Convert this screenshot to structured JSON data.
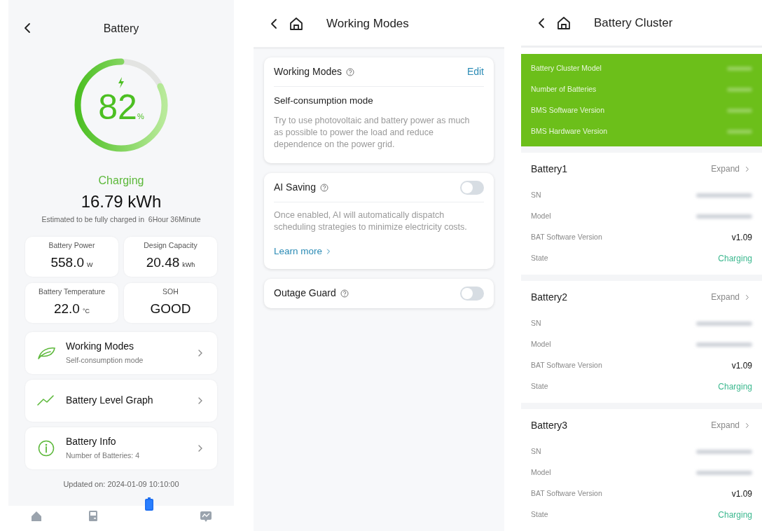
{
  "battery_screen": {
    "title": "Battery",
    "level": 0.82,
    "percent": "82",
    "percent_unit": "%",
    "status": "Charging",
    "energy": "16.79 kWh",
    "estimate": "Estimated to be fully charged in  6Hour 36Minute",
    "stats": [
      {
        "label": "Battery Power",
        "value": "558.0",
        "unit": "W"
      },
      {
        "label": "Design Capacity",
        "value": "20.48",
        "unit": "kWh"
      },
      {
        "label": "Battery Temperature",
        "value": "22.0",
        "unit": "°C"
      },
      {
        "label": "SOH",
        "value": "GOOD"
      }
    ],
    "menu": [
      {
        "kind": "leaf",
        "title": "Working Modes",
        "subtitle": "Self-consumption mode"
      },
      {
        "kind": "graph",
        "title": "Battery Level Graph"
      },
      {
        "kind": "info",
        "title": "Battery Info",
        "subtitle": "Number of Batteries: 4"
      }
    ],
    "updated": "Updated on: 2024-01-09 10:10:00",
    "nav": [
      {
        "kind": "home",
        "selected": false
      },
      {
        "kind": "device",
        "selected": false
      },
      {
        "kind": "battery",
        "selected": true
      },
      {
        "kind": "analysis",
        "selected": false
      }
    ]
  },
  "working_modes_screen": {
    "title": "Working Modes",
    "cards": [
      {
        "kind": "mode",
        "title": "Working Modes",
        "action": "Edit",
        "subtitle": "Self-consumption mode",
        "description": "Try to use photovoltaic and battery power as much as possible to power the load and reduce dependence on the power grid."
      },
      {
        "kind": "toggle",
        "title": "AI Saving",
        "on": false,
        "description": "Once enabled, AI will automatically dispatch scheduling strategies to minimize electricity costs.",
        "link": "Learn more"
      },
      {
        "kind": "toggle",
        "title": "Outage Guard",
        "on": false
      }
    ]
  },
  "cluster_screen": {
    "title": "Battery Cluster",
    "summary": [
      "Battery Cluster Model",
      "Number of Batteries",
      "BMS Software Version",
      "BMS Hardware Version"
    ],
    "batteries": [
      {
        "name": "Battery1",
        "action": "Expand",
        "rows": [
          {
            "kind": "hidden",
            "label": "SN"
          },
          {
            "kind": "hidden",
            "label": "Model"
          },
          {
            "kind": "text",
            "label": "BAT Software Version",
            "value": "v1.09"
          },
          {
            "kind": "status",
            "label": "State",
            "value": "Charging"
          }
        ]
      },
      {
        "name": "Battery2",
        "action": "Expand",
        "rows": [
          {
            "kind": "hidden",
            "label": "SN"
          },
          {
            "kind": "hidden",
            "label": "Model"
          },
          {
            "kind": "text",
            "label": "BAT Software Version",
            "value": "v1.09"
          },
          {
            "kind": "status",
            "label": "State",
            "value": "Charging"
          }
        ]
      },
      {
        "name": "Battery3",
        "action": "Expand",
        "rows": [
          {
            "kind": "hidden",
            "label": "SN"
          },
          {
            "kind": "hidden",
            "label": "Model"
          },
          {
            "kind": "text",
            "label": "BAT Software Version",
            "value": "v1.09"
          },
          {
            "kind": "status",
            "label": "State",
            "value": "Charging"
          }
        ]
      }
    ]
  }
}
